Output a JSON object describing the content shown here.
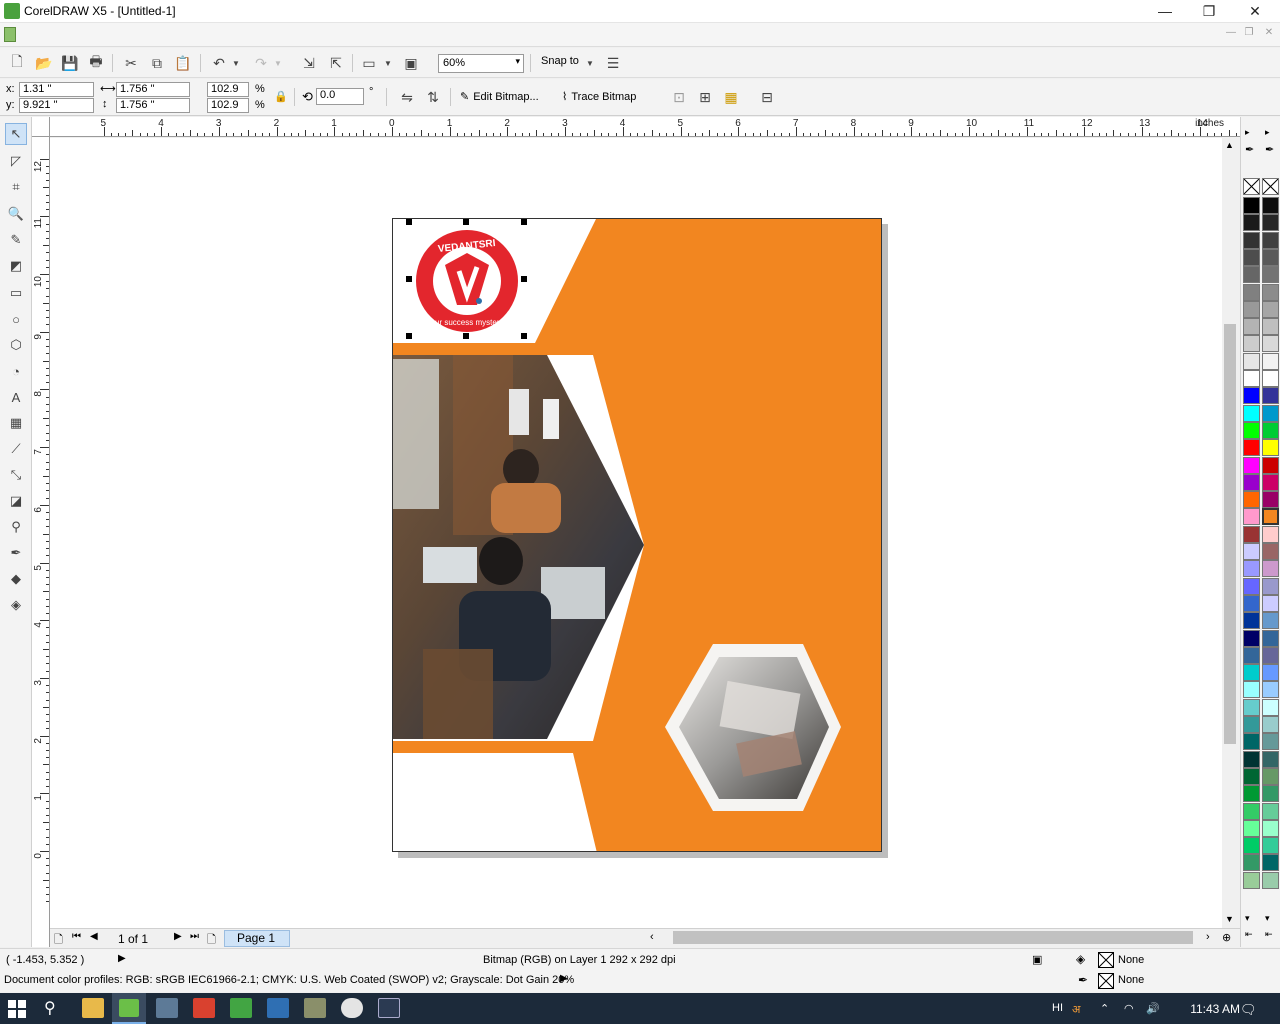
{
  "window": {
    "title": "CorelDRAW X5 - [Untitled-1]",
    "minimize": "—",
    "maximize": "❐",
    "close": "✕"
  },
  "toolbar": {
    "zoom_value": "60%",
    "snap_label": "Snap to"
  },
  "property_bar": {
    "x_label": "x:",
    "y_label": "y:",
    "x_value": "1.31 \"",
    "y_value": "9.921 \"",
    "width_value": "1.756 \"",
    "height_value": "1.756 \"",
    "scale_x": "102.9",
    "scale_y": "102.9",
    "percent": "%",
    "rotation": "0.0",
    "degree": "°",
    "edit_bitmap": "Edit Bitmap...",
    "trace_bitmap": "Trace Bitmap"
  },
  "ruler": {
    "unit": "inches",
    "h_labels": [
      "5",
      "4",
      "3",
      "2",
      "1",
      "0",
      "1",
      "2",
      "3",
      "4",
      "5",
      "6",
      "7",
      "8",
      "9",
      "10",
      "11",
      "12",
      "13",
      "14"
    ],
    "v_labels": [
      "12",
      "11",
      "10",
      "9",
      "8",
      "7",
      "6",
      "5",
      "4",
      "3",
      "2",
      "1",
      "0"
    ]
  },
  "logo": {
    "top_text": "VEDANTSRI",
    "bottom_text": "our success mystery"
  },
  "page_nav": {
    "count": "1 of 1",
    "tab": "Page 1"
  },
  "status": {
    "coords": "( -1.453, 5.352 )",
    "object_info": "Bitmap (RGB) on Layer 1 292 x 292 dpi",
    "fill_label": "None",
    "outline_label": "None",
    "color_profiles": "Document color profiles: RGB: sRGB IEC61966-2.1; CMYK: U.S. Web Coated (SWOP) v2; Grayscale: Dot Gain 20%"
  },
  "taskbar": {
    "lang": "HI",
    "time": "11:43 AM"
  },
  "colors": {
    "orange": "#f28620",
    "logo_red": "#e3262d",
    "selection": "#000000"
  },
  "palette": {
    "col1": [
      "#000000",
      "#1a1a1a",
      "#333333",
      "#4d4d4d",
      "#666666",
      "#808080",
      "#999999",
      "#b3b3b3",
      "#cccccc",
      "#e6e6e6",
      "#ffffff",
      "#0000ff",
      "#00ffff",
      "#00ff00",
      "#ff0000",
      "#ff00ff",
      "#9900cc",
      "#ff6600",
      "#ff99cc",
      "#993333",
      "#ccccff",
      "#9999ff",
      "#6666ff",
      "#3366cc",
      "#003399",
      "#000066",
      "#336699",
      "#00cccc",
      "#99ffff",
      "#66cccc",
      "#339999",
      "#006666",
      "#003333",
      "#006633",
      "#009933",
      "#33cc66",
      "#66ff99",
      "#00cc66",
      "#339966",
      "#99cc99"
    ],
    "col2": [
      "#0d0d0d",
      "#262626",
      "#404040",
      "#595959",
      "#737373",
      "#8c8c8c",
      "#a6a6a6",
      "#bfbfbf",
      "#d9d9d9",
      "#f2f2f2",
      "#ffffff",
      "#333399",
      "#0099cc",
      "#00cc33",
      "#ffff00",
      "#cc0000",
      "#cc0066",
      "#990066",
      "#f28620",
      "#ffcccc",
      "#996666",
      "#cc99cc",
      "#9999cc",
      "#ccccff",
      "#6699cc",
      "#336699",
      "#666699",
      "#6699ff",
      "#99ccff",
      "#ccffff",
      "#99cccc",
      "#669999",
      "#336666",
      "#669966",
      "#339966",
      "#66cc99",
      "#99ffcc",
      "#33cc99",
      "#006666",
      "#99ccaa"
    ]
  }
}
